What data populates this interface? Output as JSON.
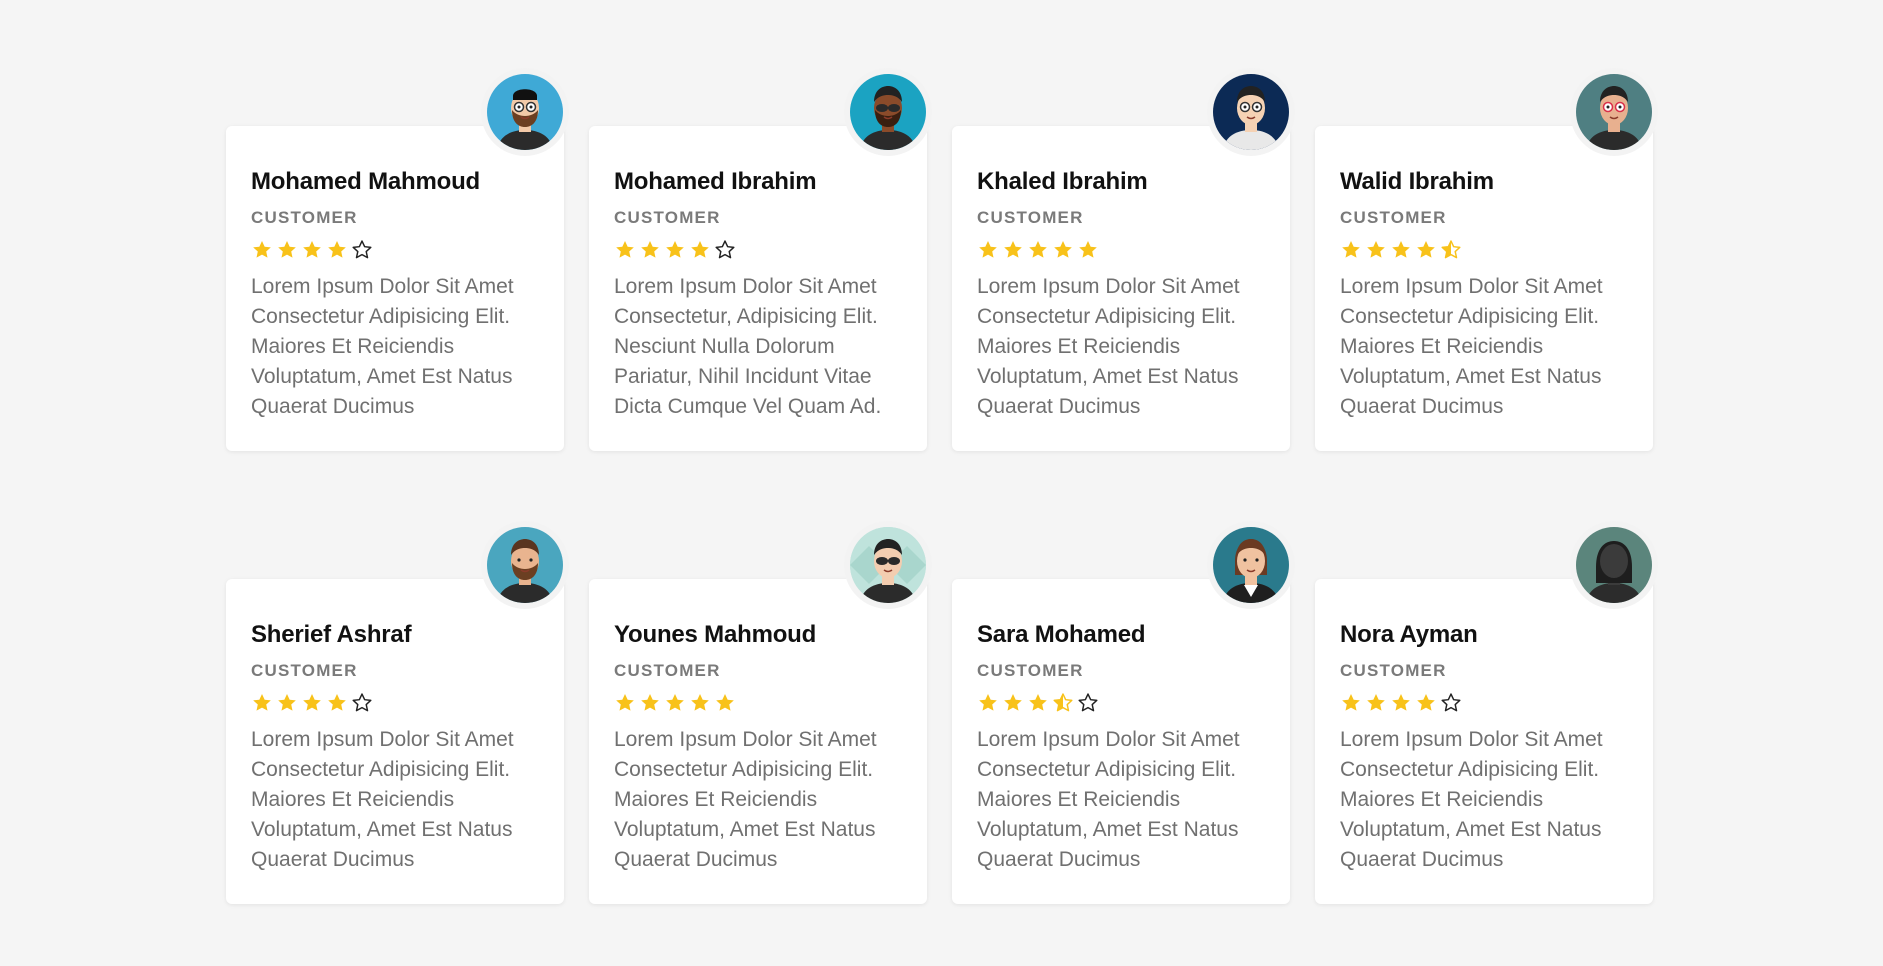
{
  "colors": {
    "background": "#f5f5f5",
    "card": "#ffffff",
    "star": "#f8c21a",
    "name": "#111111",
    "role": "#7a7a7a",
    "text": "#707070"
  },
  "testimonials": [
    {
      "name": "Mohamed Mahmoud",
      "role": "CUSTOMER",
      "rating": 4,
      "avatar": "avatar-glasses-beard-man",
      "avatar_bg": "#3fa9d6",
      "text": "Lorem Ipsum Dolor Sit Amet Consectetur Adipisicing Elit. Maiores Et Reiciendis Voluptatum, Amet Est Natus Quaerat Ducimus"
    },
    {
      "name": "Mohamed Ibrahim",
      "role": "CUSTOMER",
      "rating": 4,
      "avatar": "avatar-sunglasses-man",
      "avatar_bg": "#1ba3c2",
      "text": "Lorem Ipsum Dolor Sit Amet Consectetur, Adipisicing Elit. Nesciunt Nulla Dolorum Pariatur, Nihil Incidunt Vitae Dicta Cumque Vel Quam Ad."
    },
    {
      "name": "Khaled Ibrahim",
      "role": "CUSTOMER",
      "rating": 5,
      "avatar": "avatar-glasses-man",
      "avatar_bg": "#0c2a55",
      "text": "Lorem Ipsum Dolor Sit Amet Consectetur Adipisicing Elit. Maiores Et Reiciendis Voluptatum, Amet Est Natus Quaerat Ducimus"
    },
    {
      "name": "Walid Ibrahim",
      "role": "CUSTOMER",
      "rating": 4.5,
      "avatar": "avatar-red-glasses-man",
      "avatar_bg": "#4f7f82",
      "text": "Lorem Ipsum Dolor Sit Amet Consectetur Adipisicing Elit. Maiores Et Reiciendis Voluptatum, Amet Est Natus Quaerat Ducimus"
    },
    {
      "name": "Sherief Ashraf",
      "role": "CUSTOMER",
      "rating": 4,
      "avatar": "avatar-bearded-man",
      "avatar_bg": "#4aa6bf",
      "text": "Lorem Ipsum Dolor Sit Amet Consectetur Adipisicing Elit. Maiores Et Reiciendis Voluptatum, Amet Est Natus Quaerat Ducimus"
    },
    {
      "name": "Younes Mahmoud",
      "role": "CUSTOMER",
      "rating": 5,
      "avatar": "avatar-aviator-man",
      "avatar_bg": "#bfe3dc",
      "text": "Lorem Ipsum Dolor Sit Amet Consectetur Adipisicing Elit. Maiores Et Reiciendis Voluptatum, Amet Est Natus Quaerat Ducimus"
    },
    {
      "name": "Sara Mohamed",
      "role": "CUSTOMER",
      "rating": 3.5,
      "avatar": "avatar-woman",
      "avatar_bg": "#2a7a8c",
      "text": "Lorem Ipsum Dolor Sit Amet Consectetur Adipisicing Elit. Maiores Et Reiciendis Voluptatum, Amet Est Natus Quaerat Ducimus"
    },
    {
      "name": "Nora Ayman",
      "role": "CUSTOMER",
      "rating": 4,
      "avatar": "avatar-dark-hair-woman",
      "avatar_bg": "#5b857c",
      "text": "Lorem Ipsum Dolor Sit Amet Consectetur Adipisicing Elit. Maiores Et Reiciendis Voluptatum, Amet Est Natus Quaerat Ducimus"
    }
  ]
}
